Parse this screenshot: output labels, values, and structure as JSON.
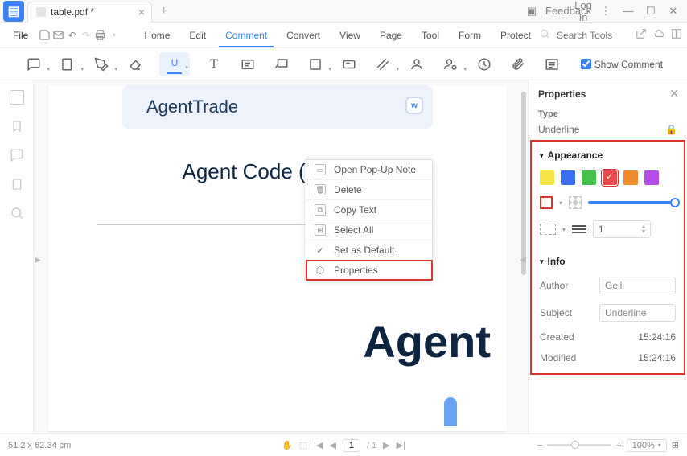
{
  "tab": {
    "label": "table.pdf *"
  },
  "titlebar": {
    "feedback": "Feedback",
    "login": "Log In"
  },
  "menus": {
    "file": "File",
    "tabs": [
      "Home",
      "Edit",
      "Comment",
      "Convert",
      "View",
      "Page",
      "Tool",
      "Form",
      "Protect"
    ],
    "active_index": 2,
    "search_placeholder": "Search Tools"
  },
  "toolbar": {
    "show_comment": "Show Comment"
  },
  "document": {
    "band_title": "AgentTrade",
    "heading": "Agent Code (Codes)",
    "big_text": "Agent"
  },
  "context_menu": {
    "items": [
      "Open Pop-Up Note",
      "Delete",
      "Copy Text",
      "Select All",
      "Set as Default",
      "Properties"
    ]
  },
  "properties": {
    "title": "Properties",
    "type_label": "Type",
    "type_value": "Underline",
    "appearance_label": "Appearance",
    "swatches": [
      "#f6e34a",
      "#3b6ef0",
      "#45c24a",
      "#e94b4b",
      "#f08a2b",
      "#b74be9"
    ],
    "selected_swatch": 3,
    "thickness": "1",
    "info_label": "Info",
    "author_label": "Author",
    "author": "Geili",
    "subject_label": "Subject",
    "subject": "Underline",
    "created_label": "Created",
    "created": "15:24:16",
    "modified_label": "Modified",
    "modified": "15:24:16"
  },
  "status": {
    "coords": "51.2 x 62.34 cm",
    "page_current": "1",
    "page_total": "/ 1",
    "zoom": "100%"
  }
}
